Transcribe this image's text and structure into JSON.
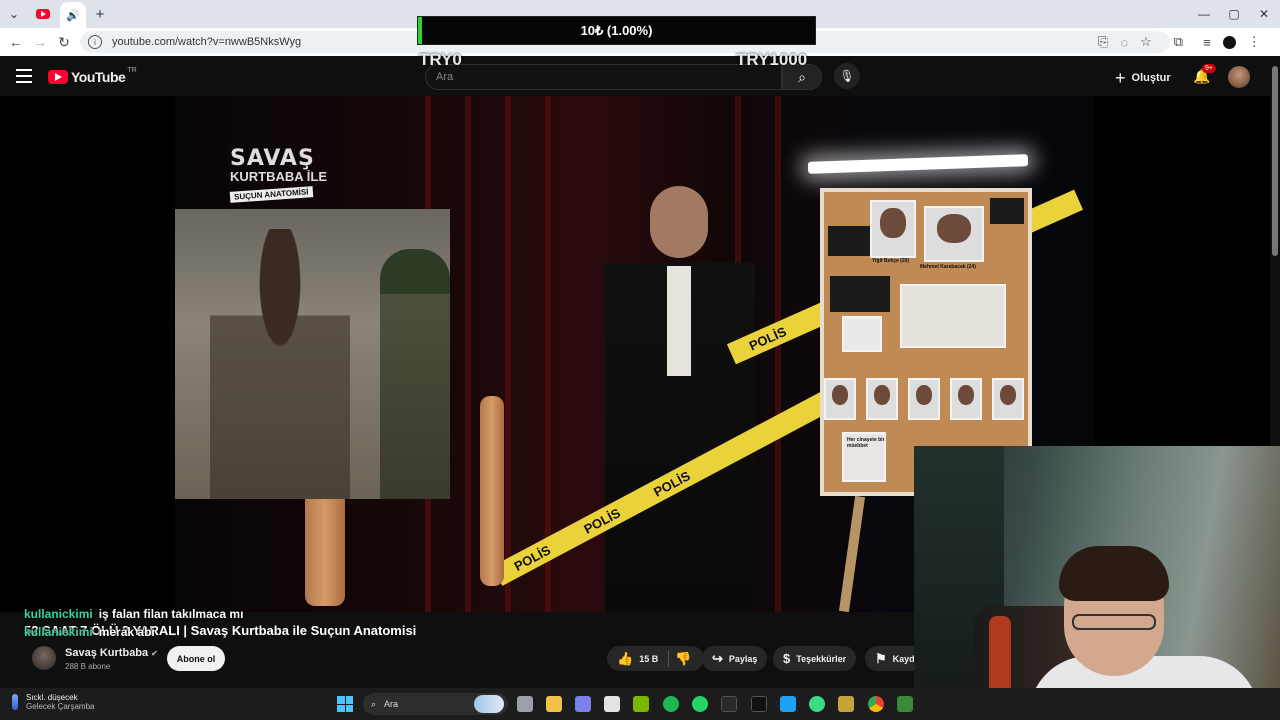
{
  "browser": {
    "url": "youtube.com/watch?v=nwwB5NksWyg",
    "tab_active_icon": "speaker-icon"
  },
  "overlay": {
    "donation_text": "10₺ (1.00%)",
    "donation_progress": 0.01,
    "donation_min": "TRY0",
    "donation_max": "TRY1000",
    "bar_color": "#2fd32f"
  },
  "youtube": {
    "logo_text": "YouTube",
    "country_code": "TR",
    "search_placeholder": "Ara",
    "create_label": "Oluştur",
    "notifications_badge": "9+",
    "accent": "#ff0033"
  },
  "video_frame": {
    "show_logo_line1": "SAVAŞ",
    "show_logo_line2": "KURTBABA İLE",
    "show_logo_line3": "SUÇUN ANATOMİSİ",
    "tape_text": "POLİS",
    "board_names": [
      "Yiğit Bekçe (20)",
      "Mehmet Karabacak (24)"
    ],
    "board_note": "Her cinayete bir müebbet"
  },
  "chat": [
    {
      "user": "kullanickimi",
      "message": "iş falan filan takılmaca mı"
    },
    {
      "user": "kullanickimi",
      "message": "merak abi"
    }
  ],
  "video": {
    "title": "52 SAAT 7 ÖLÜ 2 YARALI | Savaş Kurtbaba ile Suçun Anatomisi",
    "channel_name": "Savaş Kurtbaba",
    "subscribers": "288 B abone",
    "subscribe_label": "Abone ol",
    "likes": "15 B",
    "share_label": "Paylaş",
    "thanks_label": "Teşekkürler",
    "save_label": "Kaydet"
  },
  "taskbar": {
    "weather_line1": "Sıckl. düşecek",
    "weather_line2": "Gelecek Çarşamba",
    "search_label": "Ara"
  }
}
